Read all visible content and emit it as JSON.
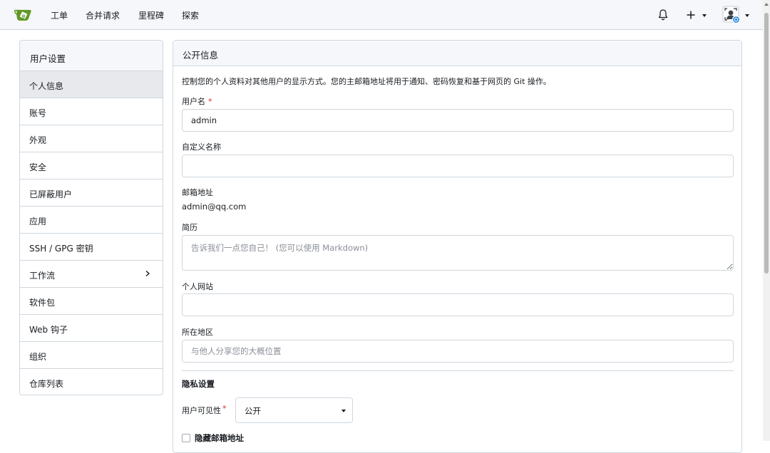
{
  "nav": {
    "items": [
      "工单",
      "合并请求",
      "里程碑",
      "探索"
    ],
    "icons": {
      "logo": "gitea-logo-icon",
      "notifications": "bell-icon",
      "create": "plus-icon",
      "user": "avatar-icon"
    },
    "brand_color": "#609926"
  },
  "sidebar": {
    "title": "用户设置",
    "items": [
      {
        "label": "个人信息",
        "active": true
      },
      {
        "label": "账号"
      },
      {
        "label": "外观"
      },
      {
        "label": "安全"
      },
      {
        "label": "已屏蔽用户"
      },
      {
        "label": "应用"
      },
      {
        "label": "SSH / GPG 密钥"
      },
      {
        "label": "工作流",
        "has_submenu": true
      },
      {
        "label": "软件包"
      },
      {
        "label": "Web 钩子"
      },
      {
        "label": "组织"
      },
      {
        "label": "仓库列表"
      }
    ]
  },
  "main": {
    "title": "公开信息",
    "description": "控制您的个人资料对其他用户的显示方式。您的主邮箱地址将用于通知、密码恢复和基于网页的 Git 操作。",
    "username": {
      "label": "用户名",
      "required_mark": "*",
      "value": "admin"
    },
    "full_name": {
      "label": "自定义名称",
      "value": ""
    },
    "email": {
      "label": "邮箱地址",
      "value": "admin@qq.com"
    },
    "bio": {
      "label": "简历",
      "placeholder": "告诉我们一点您自己！ (您可以使用 Markdown)"
    },
    "website": {
      "label": "个人网站",
      "value": ""
    },
    "location": {
      "label": "所在地区",
      "placeholder": "与他人分享您的大概位置"
    },
    "privacy": {
      "title": "隐私设置",
      "visibility_label": "用户可见性",
      "required_mark": "*",
      "visibility_value": "公开",
      "hide_email_label": "隐藏邮箱地址"
    }
  }
}
